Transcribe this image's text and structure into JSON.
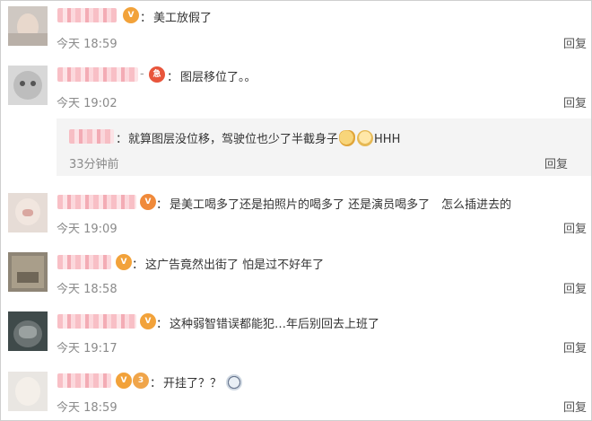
{
  "reply_label": "回复",
  "comments": [
    {
      "text": "美工放假了",
      "time": "今天 18:59"
    },
    {
      "text": "图层移位了。。",
      "time": "今天 19:02",
      "sub": {
        "text": "就算图层没位移，驾驶位也少了半截身子",
        "suffix": "HHH",
        "time": "33分钟前"
      }
    },
    {
      "text": "是美工喝多了还是拍照片的喝多了 还是演员喝多了　怎么插进去的",
      "time": "今天 19:09"
    },
    {
      "text": "这广告竟然出街了 怕是过不好年了",
      "time": "今天 18:58"
    },
    {
      "text": "这种弱智错误都能犯…年后别回去上班了",
      "time": "今天 19:17"
    },
    {
      "text": "开挂了？？",
      "time": "今天 18:59"
    }
  ]
}
